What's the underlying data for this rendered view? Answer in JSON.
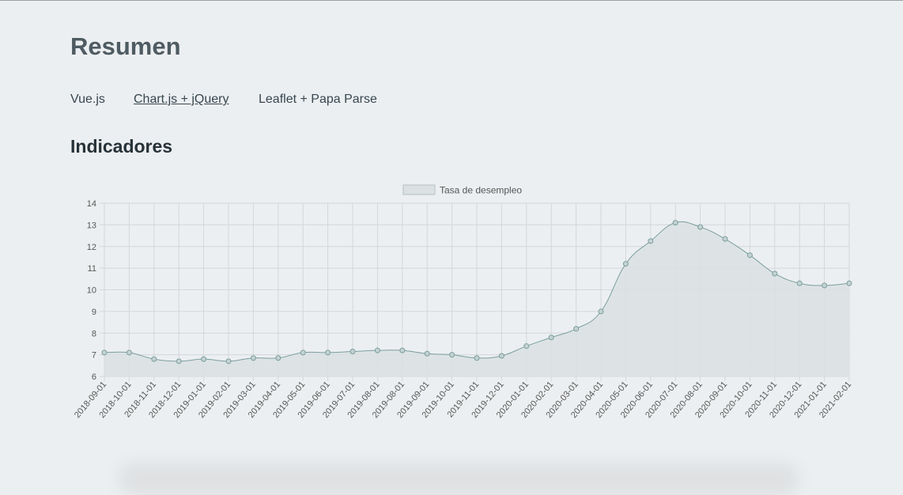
{
  "header": {
    "title": "Resumen"
  },
  "nav": {
    "items": [
      {
        "label": "Vue.js"
      },
      {
        "label": "Chart.js + jQuery"
      },
      {
        "label": "Leaflet + Papa Parse"
      }
    ]
  },
  "section": {
    "title": "Indicadores"
  },
  "colors": {
    "line": "#7a9e9f",
    "fill": "#dbe1e2",
    "point_fill": "#c6d2d3",
    "grid": "#d4d7d9"
  },
  "chart_data": {
    "type": "line",
    "legend": {
      "position": "top-center"
    },
    "grid": true,
    "ylim": [
      6,
      14
    ],
    "yticks": [
      6,
      7,
      8,
      9,
      10,
      11,
      12,
      13,
      14
    ],
    "categories": [
      "2018-09-01",
      "2018-10-01",
      "2018-11-01",
      "2018-12-01",
      "2019-01-01",
      "2019-02-01",
      "2019-03-01",
      "2019-04-01",
      "2019-05-01",
      "2019-06-01",
      "2019-07-01",
      "2019-08-01",
      "2019-08-01",
      "2019-09-01",
      "2019-10-01",
      "2019-11-01",
      "2019-12-01",
      "2020-01-01",
      "2020-02-01",
      "2020-03-01",
      "2020-04-01",
      "2020-05-01",
      "2020-06-01",
      "2020-07-01",
      "2020-08-01",
      "2020-09-01",
      "2020-10-01",
      "2020-11-01",
      "2020-12-01",
      "2021-01-01",
      "2021-02-01"
    ],
    "series": [
      {
        "name": "Tasa de desempleo",
        "values": [
          7.1,
          7.1,
          6.8,
          6.7,
          6.8,
          6.7,
          6.85,
          6.85,
          7.1,
          7.1,
          7.15,
          7.2,
          7.2,
          7.05,
          7.0,
          6.85,
          6.95,
          7.4,
          7.8,
          8.2,
          9.0,
          11.2,
          12.25,
          13.1,
          12.9,
          12.35,
          11.6,
          10.75,
          10.3,
          10.2,
          10.3
        ]
      }
    ]
  }
}
